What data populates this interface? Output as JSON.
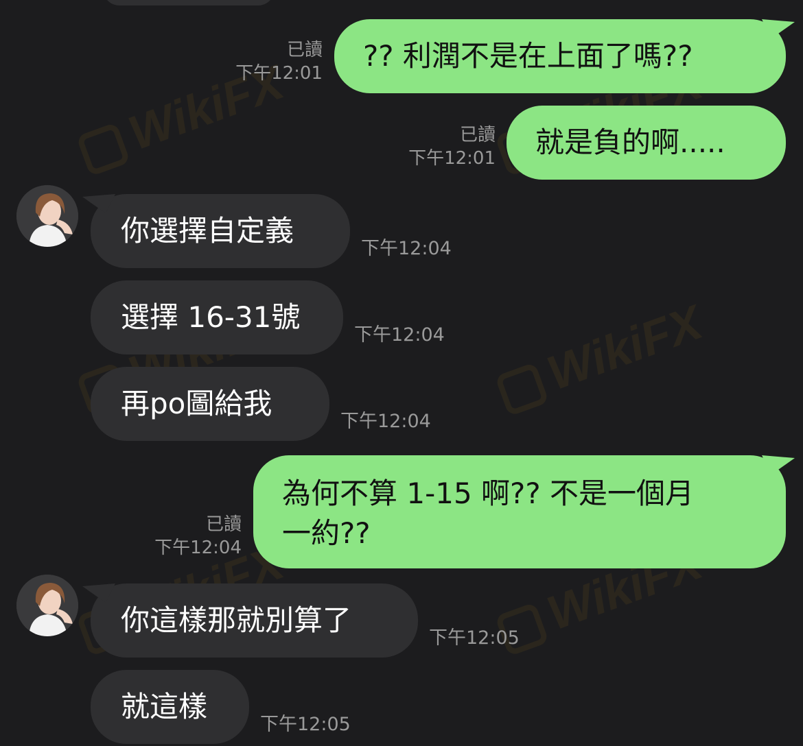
{
  "watermark": "WikiFX",
  "colors": {
    "background": "#1c1c1e",
    "outgoing_bubble": "#8ce584",
    "incoming_bubble": "#2f2f31",
    "meta_text": "#9a9a9a"
  },
  "messages": [
    {
      "dir": "out",
      "text": "?? 利潤不是在上面了嗎??",
      "read": "已讀",
      "time": "下午12:01"
    },
    {
      "dir": "out",
      "text": "就是負的啊.....",
      "read": "已讀",
      "time": "下午12:01"
    },
    {
      "dir": "in",
      "text": "你選擇自定義",
      "time": "下午12:04"
    },
    {
      "dir": "in",
      "text": "選擇 16-31號",
      "time": "下午12:04"
    },
    {
      "dir": "in",
      "text": "再po圖給我",
      "time": "下午12:04"
    },
    {
      "dir": "out",
      "line1": "為何不算 1-15 啊??   不是一個月",
      "line2": "一約??",
      "read": "已讀",
      "time": "下午12:04"
    },
    {
      "dir": "in",
      "text": "你這樣那就別算了",
      "time": "下午12:05"
    },
    {
      "dir": "in",
      "text": "就這樣",
      "time": "下午12:05"
    }
  ]
}
